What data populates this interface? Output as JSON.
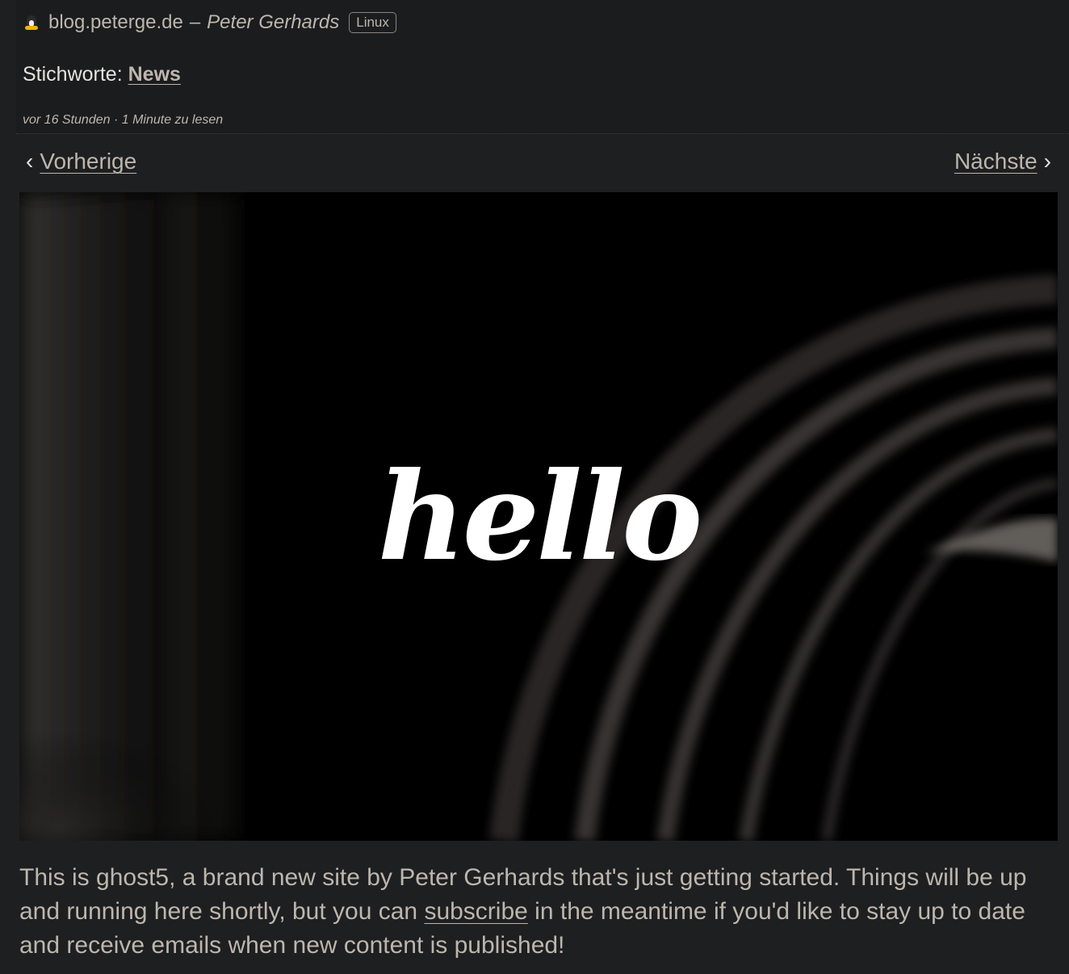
{
  "header": {
    "site": "blog.peterge.de",
    "separator": "–",
    "author": "Peter Gerhards",
    "badge": "Linux",
    "tags_label": "Stichworte:",
    "tag": "News",
    "meta": "vor 16 Stunden · 1 Minute zu lesen"
  },
  "nav": {
    "prev_chevron": "‹",
    "prev_label": "Vorherige",
    "next_label": "Nächste",
    "next_chevron": "›"
  },
  "hero": {
    "word": "hello"
  },
  "article": {
    "text_before_link": "This is ghost5, a brand new site by Peter Gerhards that's just getting started. Things will be up and running here shortly, but you can ",
    "link_text": "subscribe",
    "text_after_link": " in the meantime if you'd like to stay up to date and receive emails when new content is published!"
  },
  "colors": {
    "background": "#1e1f21",
    "text": "#bdb6ad",
    "hero_background": "#000000"
  },
  "icons": {
    "source": "tux-penguin-icon"
  }
}
